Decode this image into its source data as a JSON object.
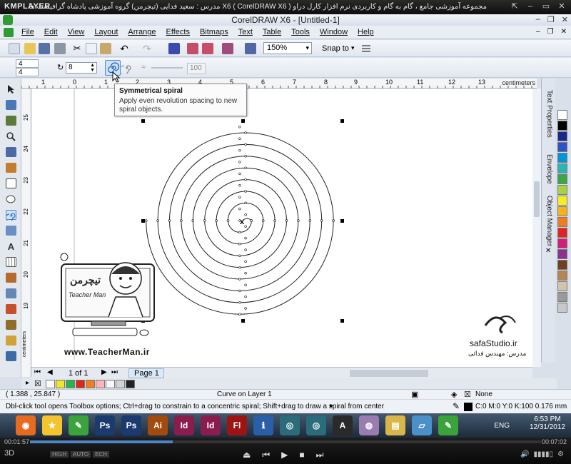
{
  "player": {
    "logo": "KMPLAYER",
    "caption": "مجموعه آموزشی جامع ، گام به گام و کاربردی نرم افزار کارل دراو X6 ( CorelDRAW X6 )   مدرس : سعید فدایی (تیچرمن) گروه آموزشی پادشاه گرافیست ها",
    "elapsed": "00:01:57",
    "total": "00:07:02",
    "progress": 0.28,
    "tags": [
      "3D",
      "HIGH",
      "AUTO",
      "ECH"
    ]
  },
  "window": {
    "title": "CorelDRAW X6 - [Untitled-1]",
    "menu": [
      "File",
      "Edit",
      "View",
      "Layout",
      "Arrange",
      "Effects",
      "Bitmaps",
      "Text",
      "Table",
      "Tools",
      "Window",
      "Help"
    ]
  },
  "standard_toolbar": {
    "zoom": "150%",
    "snap": "Snap to"
  },
  "property_bar": {
    "pos_x": "4",
    "pos_y": "4",
    "revolutions": "8",
    "expansion": "100"
  },
  "tooltip": {
    "title": "Symmetrical spiral",
    "text": "Apply even revolution spacing to new spiral objects."
  },
  "ruler": {
    "units": "centimeters",
    "h_ticks": [
      "1",
      "0",
      "1",
      "2",
      "3",
      "4",
      "5",
      "6",
      "7",
      "8",
      "9",
      "10",
      "11",
      "12",
      "13",
      "14"
    ],
    "v_ticks": [
      "25",
      "24",
      "23",
      "22",
      "21",
      "20",
      "19"
    ],
    "v_unit": "centimeters"
  },
  "dockers": [
    "Text Properties",
    "Envelope",
    "Object Manager"
  ],
  "logos": {
    "teacher_site": "www.TeacherMan.ir",
    "teacher_name": "Teacher Man",
    "teacher_fa": "تیچرمن",
    "safa_site": "safaStudio.ir",
    "safa_author": "مدرس: مهندس فدائی"
  },
  "page_nav": {
    "count": "1 of 1",
    "tab": "Page 1"
  },
  "palette_colors": [
    "#ffffff",
    "#000000",
    "#1a2a88",
    "#2e53c8",
    "#0096d6",
    "#2bb5b0",
    "#3ba54a",
    "#a8d246",
    "#f4ee23",
    "#f8b21c",
    "#ee7d1f",
    "#e2241f",
    "#d11e77",
    "#8f2f8f",
    "#6e3f22",
    "#b48655",
    "#d0c4aa",
    "#9a9a9a",
    "#c8c8c8"
  ],
  "doc_palette": [
    "#ffffff",
    "#f0e52a",
    "#2eb24b",
    "#d8281f",
    "#ef7f20",
    "#ffb5b8",
    "#f7f7f7",
    "#d4d4d4",
    "#222222"
  ],
  "status": {
    "coords": "( 1.388 , 25.847 )",
    "object": "Curve on Layer 1",
    "hint": "Dbl-click tool opens Toolbox options; Ctrl+drag to constrain to a concentric spiral; Shift+drag to draw a spiral from center",
    "fill": "None",
    "outline": "C:0 M:0 Y:0 K:100  0.176 mm"
  },
  "taskbar": {
    "apps": [
      "firefox",
      "kde",
      "corel",
      "Ps",
      "Ps",
      "Ai",
      "Id",
      "Id",
      "Fl",
      "Pw",
      "Wc",
      "Wc",
      "Gp",
      "dvd",
      "folder",
      "clip",
      "corel"
    ],
    "lang": "ENG",
    "time": "6:53 PM",
    "date": "12/31/2012"
  }
}
